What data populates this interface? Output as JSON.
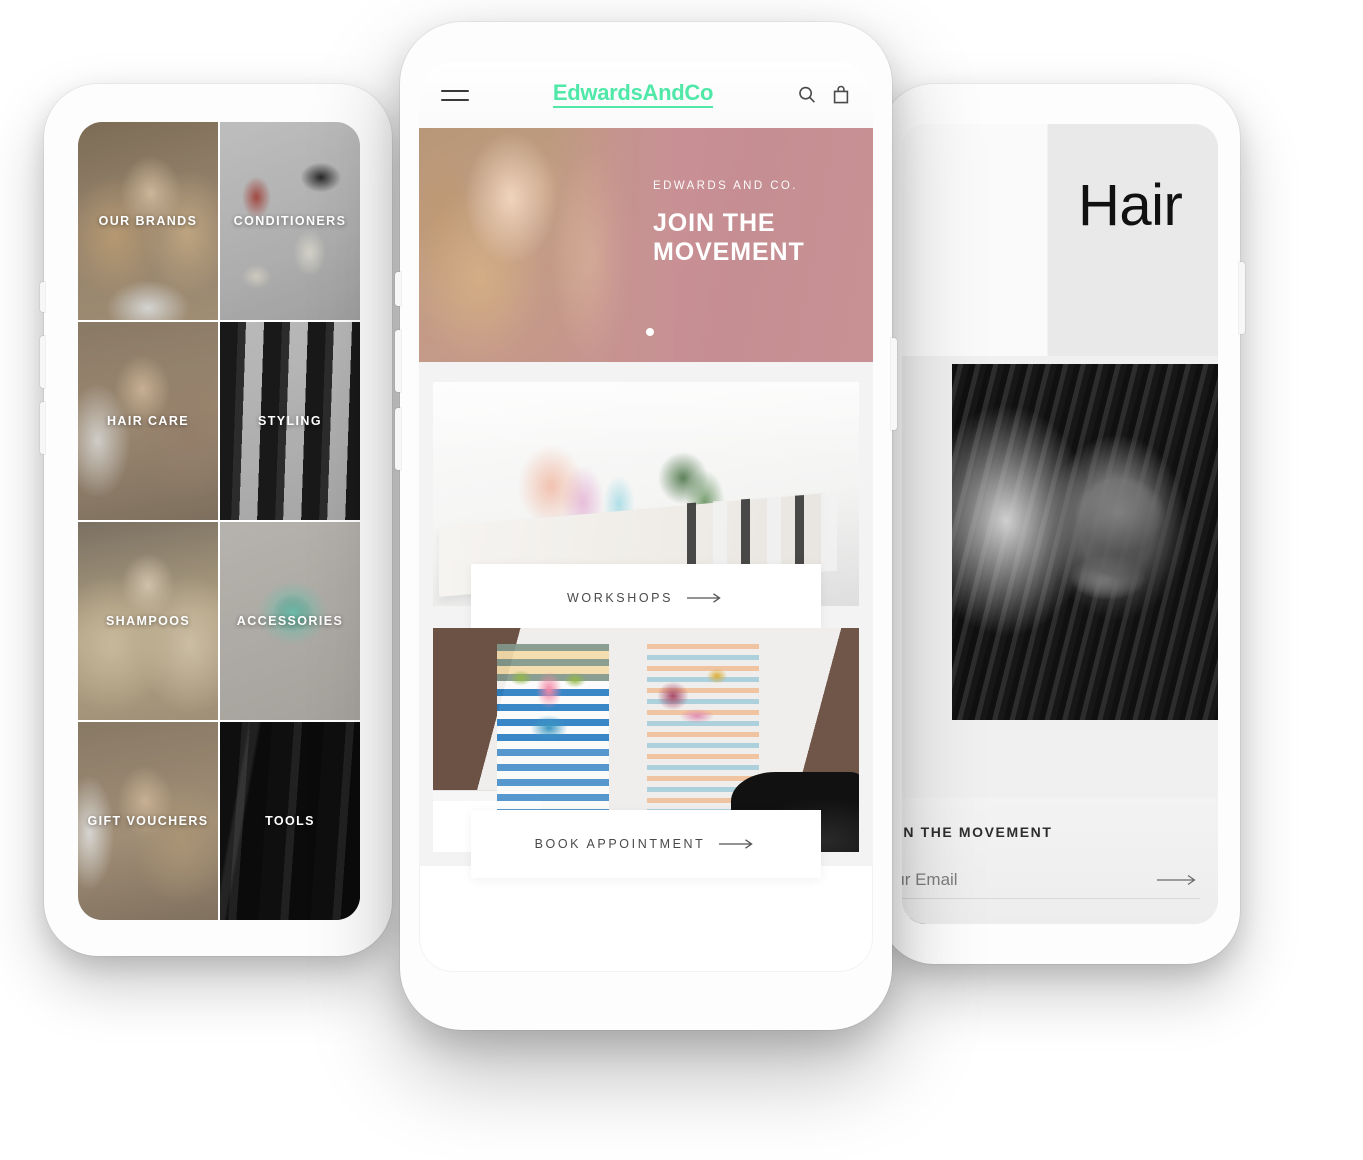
{
  "scene": {
    "description": "Three white smartphone mockups showing a hair salon e-commerce app",
    "brand_color": "#4fe8a8",
    "hero_color": "#c8939a"
  },
  "left_phone": {
    "name": "category-grid-screen",
    "tiles": [
      {
        "label": "OUR BRANDS",
        "key": "brands"
      },
      {
        "label": "CONDITIONERS",
        "key": "conditioners"
      },
      {
        "label": "HAIR CARE",
        "key": "haircare"
      },
      {
        "label": "STYLING",
        "key": "styling"
      },
      {
        "label": "SHAMPOOS",
        "key": "shampoos"
      },
      {
        "label": "ACCESSORIES",
        "key": "accessories"
      },
      {
        "label": "GIFT VOUCHERS",
        "key": "gift"
      },
      {
        "label": "TOOLS",
        "key": "tools"
      }
    ]
  },
  "center_phone": {
    "name": "home-screen",
    "header": {
      "brand": "EdwardsAndCo",
      "menu_icon": "hamburger-icon",
      "search_icon": "search-icon",
      "bag_icon": "shopping-bag-icon"
    },
    "hero": {
      "kicker": "EDWARDS AND CO.",
      "title_line1": "JOIN THE",
      "title_line2": "MOVEMENT",
      "carousel_dots": 1,
      "active_dot": 1
    },
    "promos": [
      {
        "label": "WORKSHOPS",
        "image": "salon-workshop-table-mural"
      },
      {
        "label": "BOOK APPOINTMENT",
        "image": "salon-colorful-mural-basin"
      }
    ]
  },
  "right_phone": {
    "name": "hair-category-screen",
    "title": "Hair",
    "accent_color": "#53e3a6",
    "newsletter": {
      "heading": "JOIN THE MOVEMENT",
      "input_placeholder": "Your Email",
      "submit_icon": "arrow-right-icon"
    }
  }
}
